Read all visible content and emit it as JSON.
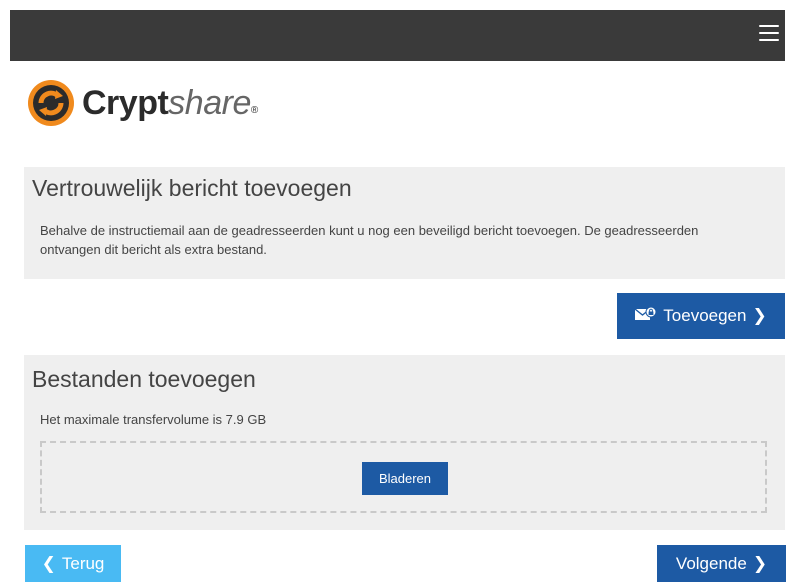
{
  "header": {
    "menu_icon": "hamburger-menu-icon"
  },
  "logo": {
    "brand_bold": "Crypt",
    "brand_italic": "share",
    "registered": "®",
    "colors": {
      "orange": "#f08a1d",
      "dark": "#2b2b2b"
    }
  },
  "message_section": {
    "title": "Vertrouwelijk bericht toevoegen",
    "description": "Behalve de instructiemail aan de geadresseerden kunt u nog een beveiligd bericht toevoegen. De geadresseerden ontvangen dit bericht als extra bestand.",
    "add_button_label": "Toevoegen",
    "add_button_icon": "envelope-lock-icon"
  },
  "files_section": {
    "title": "Bestanden toevoegen",
    "limit_text": "Het maximale transfervolume is 7.9 GB",
    "browse_button_label": "Bladeren"
  },
  "footer": {
    "back_label": "Terug",
    "next_label": "Volgende"
  },
  "colors": {
    "primary": "#1d5aa4",
    "back": "#49baf3",
    "topbar": "#3a3a3a",
    "panel": "#efefef"
  }
}
